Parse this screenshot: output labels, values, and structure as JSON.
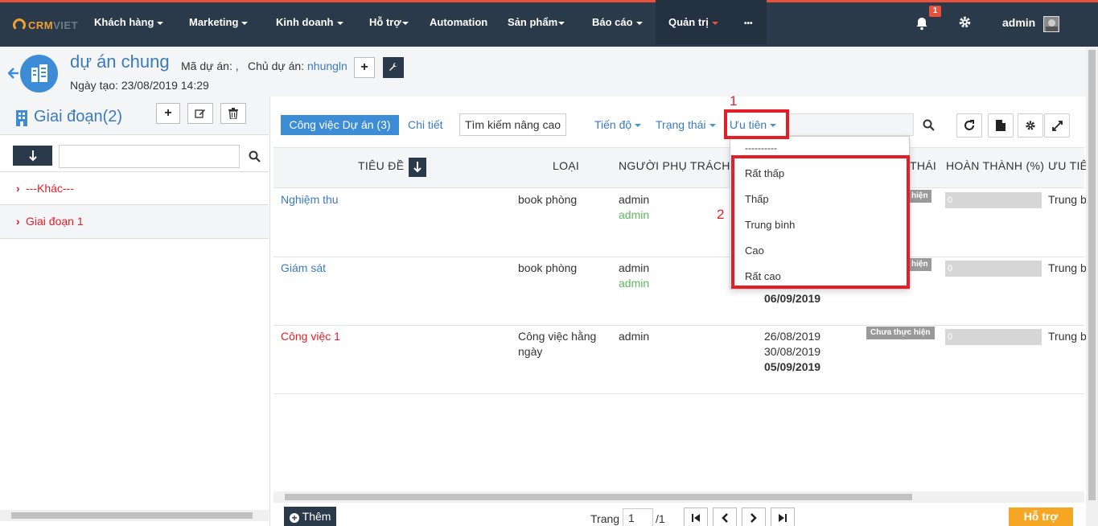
{
  "nav": {
    "logo_a": "CRM",
    "logo_b": "VIET",
    "items": [
      "Khách hàng",
      "Marketing",
      "Kinh doanh",
      "Hỗ trợ",
      "Automation",
      "Sản phẩm",
      "Báo cáo",
      "Quản trị",
      "•••"
    ],
    "notification_count": "1",
    "user": "admin"
  },
  "project": {
    "name": "dự án chung",
    "code_label": "Mã dự án: ,",
    "owner_label": "Chủ dự án:",
    "owner": "nhungln",
    "created": "Ngày tạo: 23/08/2019 14:29"
  },
  "left": {
    "title": "Giai đoạn(2)",
    "search_value": "",
    "items": [
      "---Khác---",
      "Giai đoạn 1"
    ]
  },
  "toolbar": {
    "tab_active": "Công việc Dự án (3)",
    "tab_detail": "Chi tiết",
    "advanced_search": "Tìm kiếm nâng cao",
    "filter_progress": "Tiến độ",
    "filter_status": "Trạng thái",
    "filter_priority": "Ưu tiên",
    "search_value": ""
  },
  "columns": {
    "title": "TIÊU ĐỀ",
    "type": "LOẠI",
    "owner": "NGƯỜI PHỤ TRÁCH",
    "status": "THÁI",
    "complete": "HOÀN THÀNH (%)",
    "priority": "ƯU TIÊ"
  },
  "rows": [
    {
      "title": "Nghiệm thu",
      "type": "book phòng",
      "owner": "admin",
      "owner2": "admin",
      "date1": "",
      "date2": "",
      "date3": "",
      "status": "hiện",
      "progress": "0",
      "priority": "Trung b"
    },
    {
      "title": "Giám sát",
      "type": "book phòng",
      "owner": "admin",
      "owner2": "admin",
      "date1": "",
      "date2": "",
      "date3": "06/09/2019",
      "status": "hiện",
      "progress": "0",
      "priority": "Trung b"
    },
    {
      "title": "Công việc 1",
      "type": "Công việc hằng",
      "type2": "ngày",
      "owner": "admin",
      "owner2": "",
      "date1": "26/08/2019",
      "date2": "30/08/2019",
      "date3": "05/09/2019",
      "status": "Chưa thực hiện",
      "progress": "0",
      "priority": "Trung b"
    }
  ],
  "dropdown": {
    "placeholder": "----------",
    "options": [
      "Rất thấp",
      "Thấp",
      "Trung bình",
      "Cao",
      "Rất cao"
    ]
  },
  "annotations": [
    "1",
    "2"
  ],
  "footer": {
    "add_label": "Thêm",
    "page_label": "Trang",
    "page_value": "1",
    "page_total": "/1",
    "help_label": "Hỗ trợ"
  },
  "colors": {
    "nav_bg": "#2b3a4a",
    "accent_red": "#e41e26",
    "link_blue": "#3a7bbf",
    "active_tab": "#3c8dd6",
    "help_btn": "#f5a623"
  }
}
